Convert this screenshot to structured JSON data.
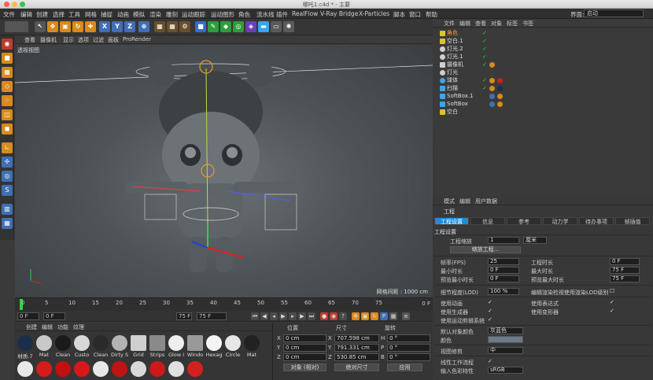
{
  "window": {
    "title": "哪吒1.c4d * - 主要"
  },
  "menubar": {
    "items": [
      "文件",
      "编辑",
      "创建",
      "选择",
      "工具",
      "网格",
      "捕捉",
      "动画",
      "模拟",
      "渲染",
      "雕刻",
      "运动跟踪",
      "运动图形",
      "角色",
      "流水线",
      "插件",
      "RealFlow",
      "V-Ray Bridge",
      "X-Particles",
      "脚本",
      "窗口",
      "帮助"
    ],
    "interface_label": "界面:",
    "interface_value": "启动"
  },
  "viewport": {
    "menu": [
      "查看",
      "摄像机",
      "显示",
      "选项",
      "过滤",
      "面板",
      "ProRender"
    ],
    "label": "透视视图",
    "grid_spacing": "网格间距 : 1000 cm"
  },
  "timeline": {
    "ticks": [
      "0",
      "5",
      "10",
      "15",
      "20",
      "25",
      "30",
      "35",
      "40",
      "45",
      "50",
      "55",
      "60",
      "65",
      "70",
      "75"
    ],
    "frame": "0 F"
  },
  "transport": {
    "start": "0 F",
    "current": "0 F",
    "end_a": "75 F",
    "end_b": "75 F"
  },
  "materials": {
    "menu": [
      "创建",
      "编辑",
      "功能",
      "纹理"
    ],
    "items": [
      {
        "label": "材质.7",
        "color": "#1b2e4a"
      },
      {
        "label": "Mat",
        "color": "#c9c9c9"
      },
      {
        "label": "Clean",
        "color": "#1a1a1a"
      },
      {
        "label": "Custo",
        "color": "#d8d8d8"
      },
      {
        "label": "Clean",
        "color": "#2a2a2a"
      },
      {
        "label": "Dirty S",
        "color": "#b3b3b3"
      },
      {
        "label": "Grid",
        "color": "#cfcfcf"
      },
      {
        "label": "Strips",
        "color": "#8a8a8a"
      },
      {
        "label": "Glow I",
        "color": "#eeeeee"
      },
      {
        "label": "Windo",
        "color": "#999999"
      },
      {
        "label": "Hexag",
        "color": "#f4f4f4"
      },
      {
        "label": "Circle",
        "color": "#e6e6e6"
      },
      {
        "label": "Mat",
        "color": "#222222"
      },
      {
        "label": "",
        "color": "#e8e8e8"
      },
      {
        "label": "",
        "color": "#d41c1c"
      },
      {
        "label": "",
        "color": "#c01010"
      },
      {
        "label": "",
        "color": "#d61818"
      },
      {
        "label": "",
        "color": "#e8e8e8"
      },
      {
        "label": "",
        "color": "#c11313"
      },
      {
        "label": "",
        "color": "#d8d8d8"
      },
      {
        "label": "",
        "color": "#cc1a1a"
      },
      {
        "label": "",
        "color": "#e0e0e0"
      },
      {
        "label": "",
        "color": "#d41f1f"
      }
    ]
  },
  "coords": {
    "headers": [
      "位置",
      "尺寸",
      "旋转"
    ],
    "rows": [
      {
        "axis": "X",
        "pos": "0 cm",
        "size": "707.598 cm",
        "rot_axis": "H",
        "rot": "0 °"
      },
      {
        "axis": "Y",
        "pos": "0 cm",
        "size": "791.331 cm",
        "rot_axis": "P",
        "rot": "0 °"
      },
      {
        "axis": "Z",
        "pos": "0 cm",
        "size": "530.85 cm",
        "rot_axis": "B",
        "rot": "0 °"
      }
    ],
    "mode": "对象 (相对)",
    "size_mode": "绝对尺寸",
    "apply": "应用"
  },
  "object_manager": {
    "menu": [
      "文件",
      "编辑",
      "查看",
      "对象",
      "标签",
      "书签"
    ],
    "objects": [
      {
        "name": "角色",
        "icon_color": "#e0c030"
      },
      {
        "name": "空白.1",
        "icon_color": "#e0c030"
      },
      {
        "name": "灯光.2",
        "icon_color": "#cfcfcf"
      },
      {
        "name": "灯光.1",
        "icon_color": "#cfcfcf"
      },
      {
        "name": "摄像机",
        "icon_color": "#cfcfcf"
      },
      {
        "name": "灯光",
        "icon_color": "#cfcfcf"
      },
      {
        "name": "球体",
        "icon_color": "#3ea4e8"
      },
      {
        "name": "扫描",
        "icon_color": "#3ea4e8"
      },
      {
        "name": "SoftBox.1",
        "icon_color": "#3ea4e8"
      },
      {
        "name": "SoftBox",
        "icon_color": "#3ea4e8"
      },
      {
        "name": "空白",
        "icon_color": "#e0c030"
      }
    ]
  },
  "attributes": {
    "menu": [
      "模式",
      "编辑",
      "用户数据"
    ],
    "title": "工程",
    "tabs": [
      "工程设置",
      "信息",
      "参考",
      "动力学",
      "待办事项",
      "帧插值"
    ],
    "section": "工程设置",
    "scale_label": "工程缩放",
    "scale_value": "1",
    "scale_unit": "厘米",
    "scale_button": "缩放工程...",
    "fps_label": "帧率(FPS)",
    "fps_value": "25",
    "project_time_label": "工程时长",
    "project_time_value": "0 F",
    "min_time_label": "最小时长",
    "min_time_value": "0 F",
    "max_time_label": "最大时长",
    "max_time_value": "75 F",
    "preview_min_label": "预览最小时长",
    "preview_min_value": "0 F",
    "preview_max_label": "预览最大时长",
    "preview_max_value": "75 F",
    "lod_label": "细节程度(LOD)",
    "lod_value": "100 %",
    "render_lod_label": "编辑渲染检视使用渲染LOD级别",
    "use_anim_label": "使用动画",
    "use_expr_label": "使用表达式",
    "use_gen_label": "使用生成器",
    "use_deform_label": "使用变形器",
    "use_motion_label": "使用运动剪辑系统",
    "default_color_label": "默认对象颜色",
    "default_color_value": "灰蓝色",
    "color_label": "颜色",
    "view_clip_label": "视图修剪",
    "view_clip_value": "中",
    "linear_label": "线性工作流程",
    "input_profile_label": "输入色彩特性",
    "input_profile_value": "sRGB"
  },
  "colors": {
    "accent": "#1e8cd8",
    "check_green": "#2bd43a",
    "viewport_center": "#6a7074"
  }
}
